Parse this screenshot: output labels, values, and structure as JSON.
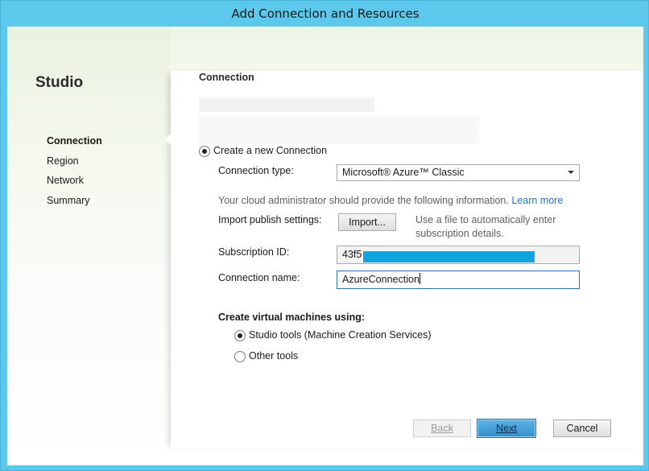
{
  "window": {
    "title": "Add Connection and Resources"
  },
  "sidebar": {
    "app_title": "Studio",
    "items": [
      {
        "label": "Connection",
        "active": true
      },
      {
        "label": "Region",
        "active": false
      },
      {
        "label": "Network",
        "active": false
      },
      {
        "label": "Summary",
        "active": false
      }
    ]
  },
  "main": {
    "section_title": "Connection",
    "create_new_radio": {
      "label": "Create a new Connection",
      "checked": true
    },
    "connection_type": {
      "label": "Connection type:",
      "selected": "Microsoft® Azure™ Classic"
    },
    "info_text": "Your cloud administrator should provide the following information.",
    "learn_more": "Learn more",
    "import_settings": {
      "label": "Import publish settings:",
      "button": "Import...",
      "hint_line1": "Use a file to automatically enter",
      "hint_line2": "subscription details."
    },
    "subscription_id": {
      "label": "Subscription ID:",
      "value": "43f5"
    },
    "connection_name": {
      "label": "Connection name:",
      "value": "AzureConnection"
    },
    "create_vms": {
      "label": "Create virtual machines using:",
      "options": [
        {
          "label": "Studio tools (Machine Creation Services)",
          "checked": true
        },
        {
          "label": "Other tools",
          "checked": false
        }
      ]
    }
  },
  "footer": {
    "back": "Back",
    "next": "Next",
    "cancel": "Cancel"
  },
  "colors": {
    "window_frame": "#5cc8ec",
    "primary_button": "#2f8fce",
    "link": "#1a74c8",
    "redaction": "#0fa5e0"
  }
}
